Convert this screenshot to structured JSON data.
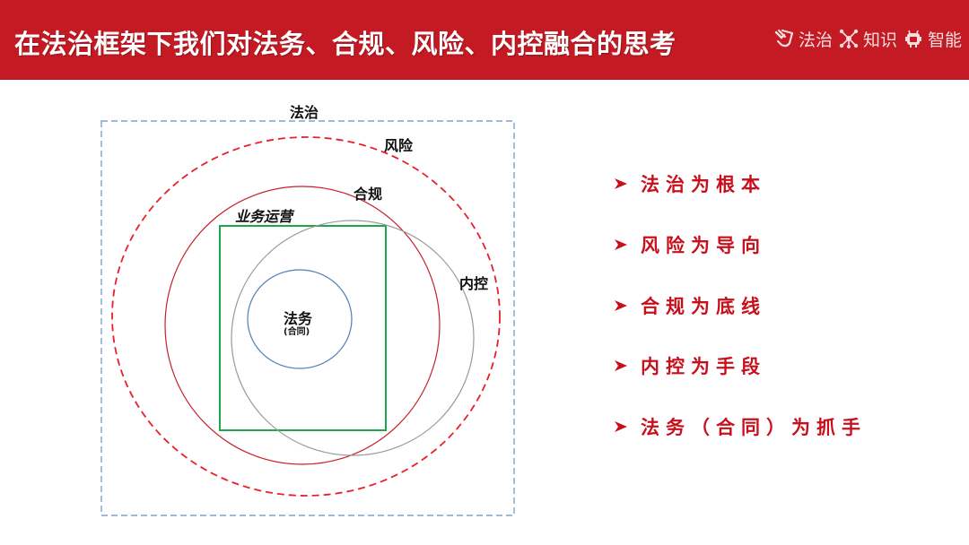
{
  "header": {
    "title": "在法治框架下我们对法务、合规、风险、内控融合的思考",
    "badges": [
      {
        "icon": "hand-check-icon",
        "label": "法治"
      },
      {
        "icon": "network-nodes-icon",
        "label": "知识"
      },
      {
        "icon": "robot-icon",
        "label": "智能"
      }
    ]
  },
  "diagram": {
    "labels": {
      "rule_of_law": "法治",
      "risk": "风险",
      "compliance": "合规",
      "business_operations": "业务运营",
      "internal_control": "内控",
      "legal_affairs": "法务",
      "contracts": "(合同)"
    },
    "colors": {
      "rule_of_law_border": "#7fa3c8",
      "risk_circle": "#e8202a",
      "compliance_circle": "#c8202a",
      "business_rect": "#1aa84a",
      "internal_control_circle": "#9a9a9a",
      "legal_circle": "#4f7fb5"
    }
  },
  "points": [
    {
      "text": "法治为根本"
    },
    {
      "text": "风险为导向"
    },
    {
      "text": "合规为底线"
    },
    {
      "text": "内控为手段"
    },
    {
      "text": "法务（合同）为抓手"
    }
  ],
  "colors": {
    "header_bg": "#c41a24",
    "accent_text": "#c8101c"
  }
}
